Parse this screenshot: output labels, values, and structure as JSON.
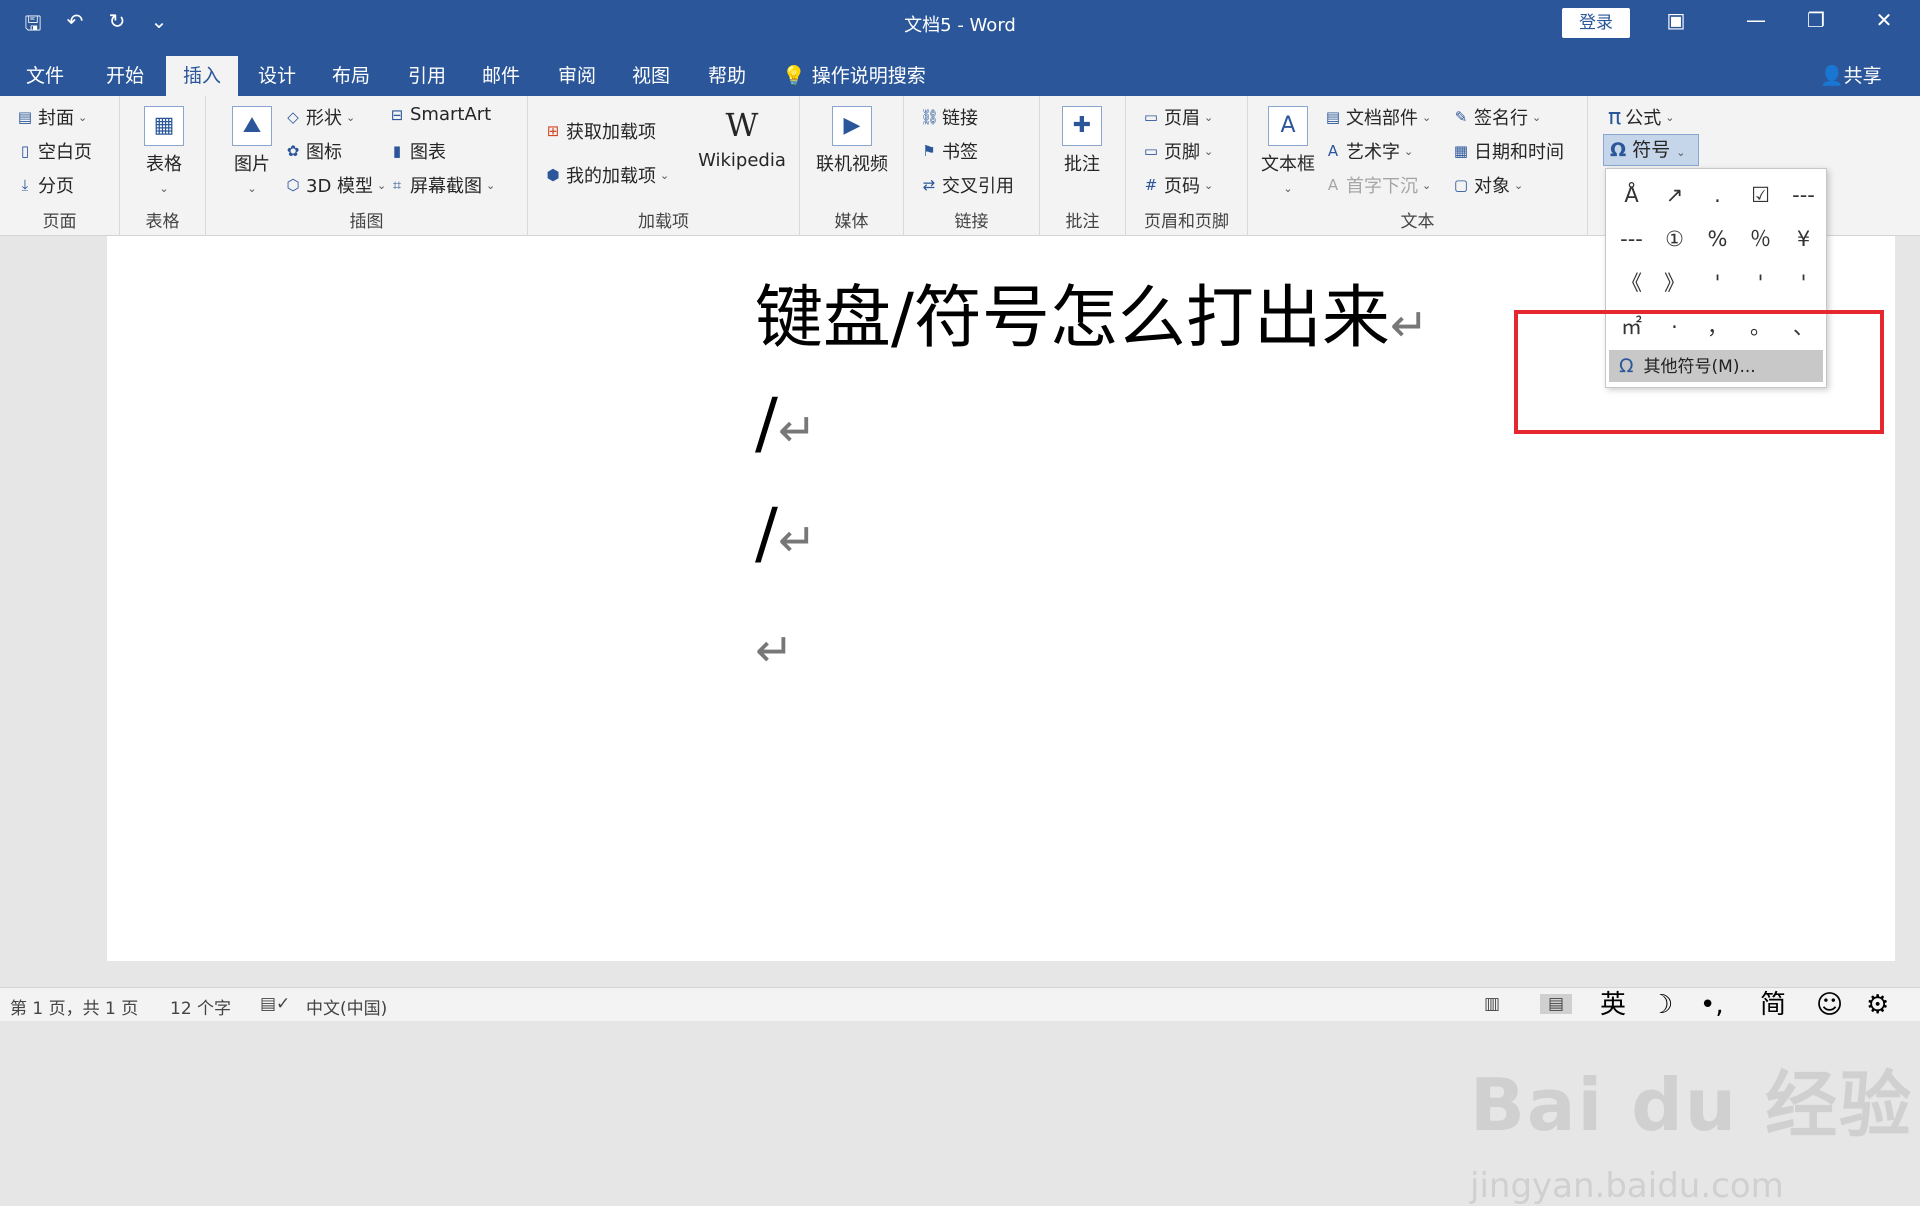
{
  "title_bar": {
    "title": "文档5 - Word",
    "login": "登录",
    "qat_icons": [
      "save-icon",
      "undo-icon",
      "redo-icon",
      "customize-icon"
    ]
  },
  "tabs": [
    "文件",
    "开始",
    "插入",
    "设计",
    "布局",
    "引用",
    "邮件",
    "审阅",
    "视图",
    "帮助"
  ],
  "tell_me": "操作说明搜索",
  "share": "共享",
  "ribbon": {
    "pages": {
      "label": "页面",
      "cover": "封面",
      "blank": "空白页",
      "break": "分页"
    },
    "tables": {
      "label": "表格",
      "table": "表格"
    },
    "illus": {
      "label": "插图",
      "picture": "图片",
      "shapes": "形状",
      "icons": "图标",
      "model3d": "3D 模型",
      "smartart": "SmartArt",
      "chart": "图表",
      "screenshot": "屏幕截图"
    },
    "addins": {
      "label": "加载项",
      "get": "获取加载项",
      "my": "我的加载项",
      "wiki": "Wikipedia",
      "wiki_logo": "W"
    },
    "media": {
      "label": "媒体",
      "video": "联机视频"
    },
    "links": {
      "label": "链接",
      "link": "链接",
      "bookmark": "书签",
      "cross": "交叉引用"
    },
    "comments": {
      "label": "批注",
      "comment": "批注"
    },
    "hf": {
      "label": "页眉和页脚",
      "header": "页眉",
      "footer": "页脚",
      "pagenum": "页码"
    },
    "text": {
      "label": "文本",
      "textbox": "文本框",
      "quickparts": "文档部件",
      "wordart": "艺术字",
      "dropcap": "首字下沉",
      "sigline": "签名行",
      "datetime": "日期和时间",
      "object": "对象"
    },
    "symbols": {
      "equation": "公式",
      "symbol": "符号",
      "pi": "π",
      "omega": "Ω"
    }
  },
  "symbol_dropdown": {
    "symbols": [
      "Å",
      "↗",
      ".",
      "☑",
      "---",
      "---",
      "①",
      "%",
      "％",
      "¥",
      "《",
      "》",
      "'",
      "'",
      "'",
      "㎡",
      "·",
      "，",
      "。",
      "、"
    ],
    "more": "其他符号(M)..."
  },
  "document": {
    "lines": [
      "键盘/符号怎么打出来",
      "/",
      "/",
      ""
    ],
    "para_mark": "↵"
  },
  "status": {
    "page": "第 1 页，共 1 页",
    "words": "12 个字",
    "lang": "中文(中国)",
    "ime": [
      "英",
      "☽",
      "•,",
      "简",
      "☺",
      "⚙"
    ]
  },
  "watermark": {
    "brand": "Bai du 经验",
    "url": "jingyan.baidu.com"
  }
}
